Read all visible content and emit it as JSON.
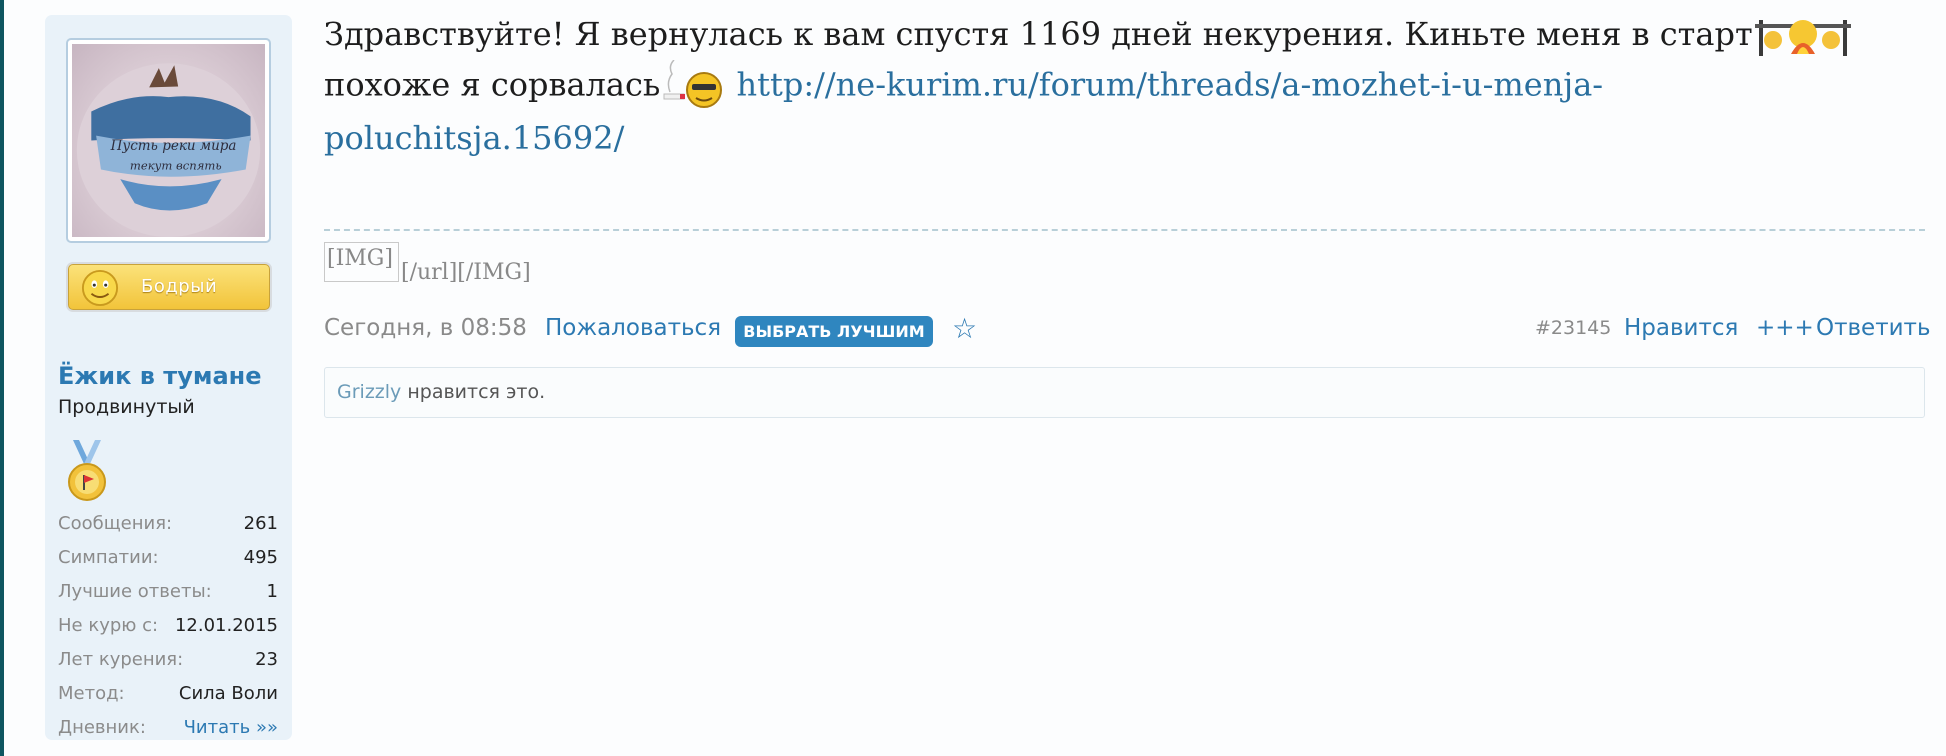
{
  "user": {
    "avatar_icon": "tattoo-avatar-image",
    "status_badge": "Бодрый",
    "name": "Ёжик в тумане",
    "title": "Продвинутый",
    "medal_icon": "medal-icon",
    "stats": [
      {
        "key": "Сообщения:",
        "value": "261"
      },
      {
        "key": "Симпатии:",
        "value": "495"
      },
      {
        "key": "Лучшие ответы:",
        "value": "1"
      },
      {
        "key": "Не курю с:",
        "value": "12.01.2015"
      },
      {
        "key": "Лет курения:",
        "value": "23"
      },
      {
        "key": "Метод:",
        "value": "Сила Воли"
      },
      {
        "key": "Дневник:",
        "value": "Читать »»"
      }
    ]
  },
  "post": {
    "line1": "Здравствуйте! Я вернулась к вам спустя 1169 дней некурения. Киньте меня в старт",
    "line2": "похоже я сорвалась",
    "link": "http://ne-kurim.ru/forum/threads/a-mozhet-i-u-menja-",
    "link_cont": "poluchitsja.15692/",
    "signature_img": "[IMG]",
    "signature_text": "[/url][/IMG]"
  },
  "meta": {
    "date": "Сегодня, в 08:58",
    "report": "Пожаловаться",
    "best": "ВЫБРАТЬ ЛУЧШИМ",
    "star_icon": "☆",
    "post_number": "#23145",
    "like": "Нравится",
    "plus": "+++",
    "reply": "Ответить"
  },
  "likes": {
    "user": "Grizzly",
    "text": " нравится это."
  },
  "colors": {
    "accent": "#2c79b2",
    "sidebar_bg": "#e9f2f9",
    "badge": "#2f86bf"
  }
}
